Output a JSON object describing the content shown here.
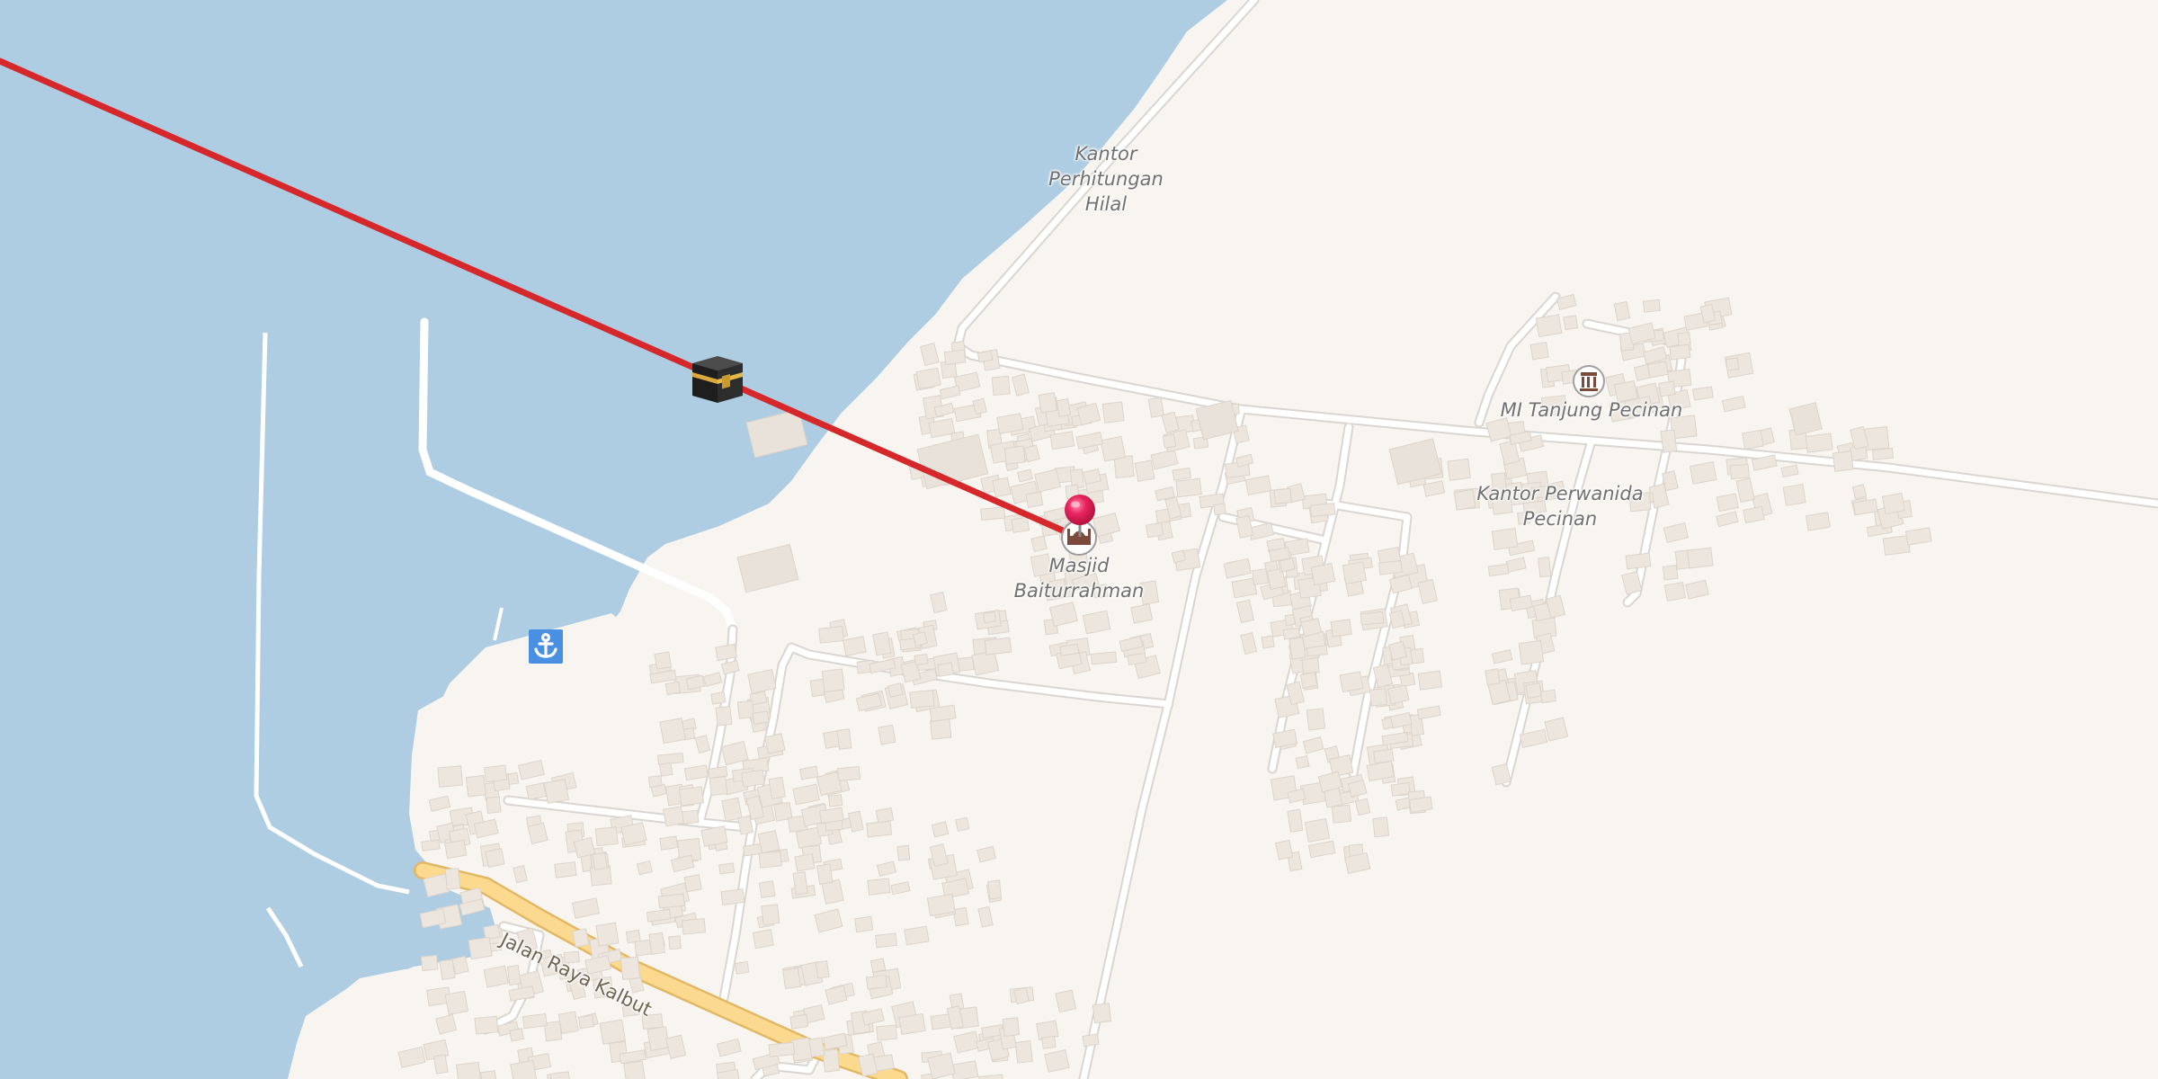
{
  "map": {
    "colors": {
      "water": "#aecde2",
      "land": "#f8f5f1",
      "road": "#ffffff",
      "road_casing": "#d9d6d2",
      "main_road": "#fbd98f",
      "main_road_casing": "#e2b865",
      "building": "#ece6df",
      "qibla_line": "#d6272b",
      "pin": "#e5195a",
      "harbour_icon": "#4a90e2",
      "label": "#707070"
    },
    "labels": {
      "kantor_perhitungan_hilal": "Kantor\nPerhitungan\nHilal",
      "mi_tanjung_pecinan": "MI Tanjung Pecinan",
      "kantor_perwanida_pecinan": "Kantor Perwanida\nPecinan",
      "masjid_baiturrahman": "Masjid\nBaiturrahman",
      "jalan_raya_kalbut": "Jalan Raya Kalbut"
    },
    "markers": {
      "location_pin": "map-pin-icon",
      "kaaba": "kaaba-icon",
      "mosque": "mosque-icon",
      "school": "school-icon",
      "harbour": "anchor-icon"
    }
  }
}
